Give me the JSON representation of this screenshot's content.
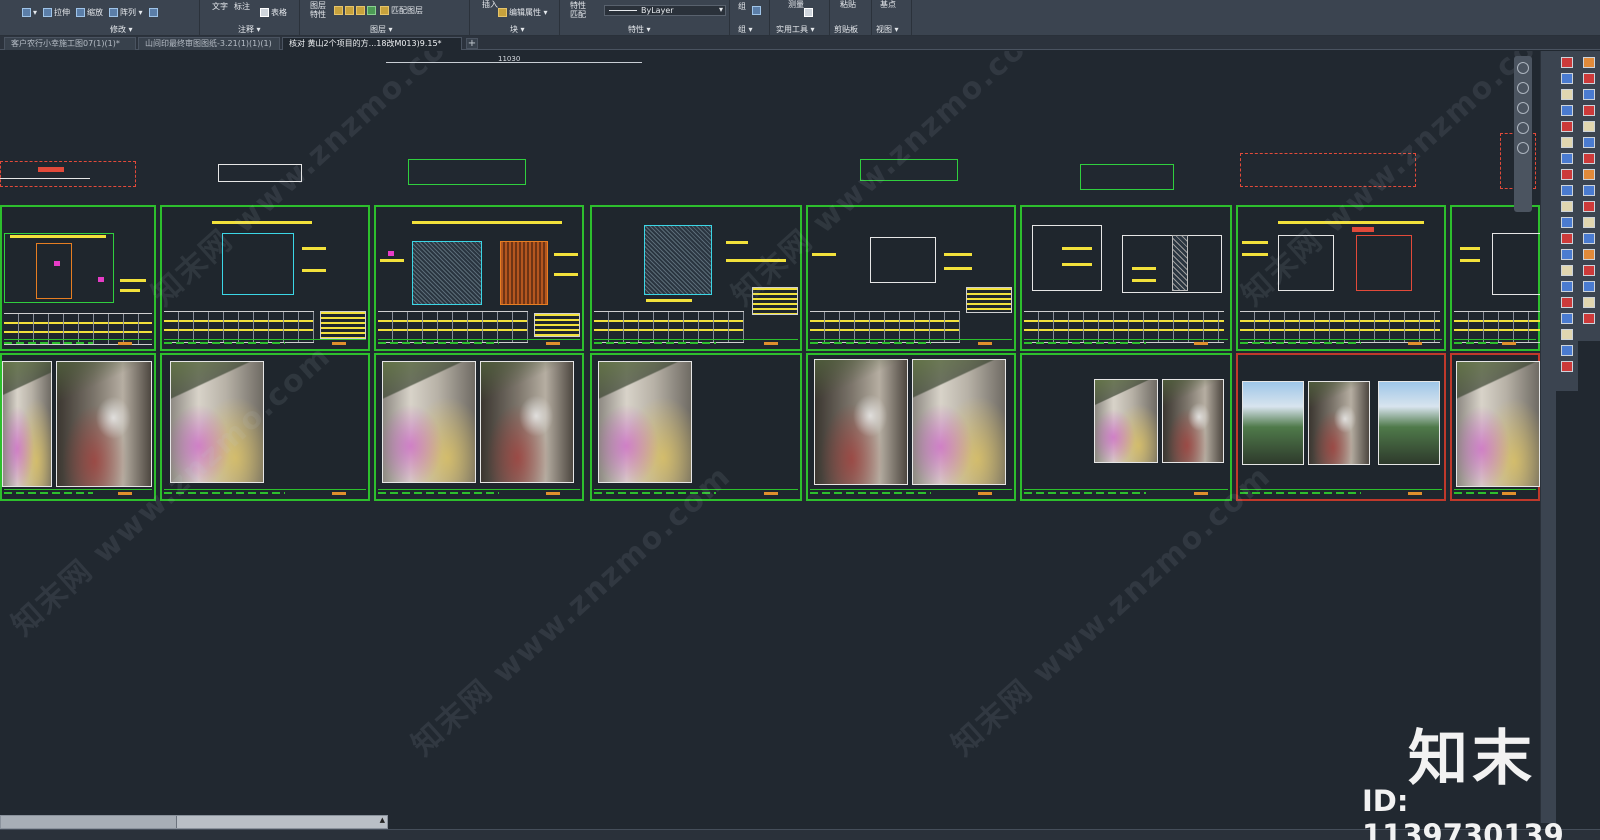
{
  "ribbon": {
    "groups": [
      {
        "name": "modify",
        "label": "修改 ▾",
        "buttons": [
          "拉伸",
          "缩放",
          "阵列 ▾"
        ]
      },
      {
        "name": "annotation",
        "label": "注释 ▾",
        "buttons": [
          "文字",
          "标注",
          "表格"
        ]
      },
      {
        "name": "layers",
        "label": "图层 ▾",
        "buttons": [
          "图层特性",
          "匹配图层"
        ]
      },
      {
        "name": "block",
        "label": "块 ▾",
        "buttons": [
          "插入",
          "编辑属性 ▾"
        ]
      },
      {
        "name": "properties",
        "label": "特性 ▾",
        "buttons": [
          "特性匹配"
        ],
        "dropdown": "ByLayer"
      },
      {
        "name": "groups",
        "label": "组 ▾",
        "buttons": [
          "组"
        ]
      },
      {
        "name": "utilities",
        "label": "实用工具 ▾",
        "buttons": [
          "测量"
        ]
      },
      {
        "name": "clipboard",
        "label": "剪贴板",
        "buttons": [
          "粘贴"
        ]
      },
      {
        "name": "view",
        "label": "视图 ▾",
        "buttons": [
          "基点"
        ]
      }
    ]
  },
  "tabs": [
    {
      "label": "客户农行小幸施工图07(1)(1)*",
      "active": false
    },
    {
      "label": "山间印最终审图图纸-3.21(1)(1)(1)",
      "active": false
    },
    {
      "label": "核对 黄山2个项目的方...18改M013)9.15*",
      "active": true
    }
  ],
  "canvas": {
    "dimension": "11030",
    "watermark": "知末网 www.znzmo.com"
  },
  "logo": {
    "text": "知末",
    "id": "ID: 1139730139"
  },
  "colors": {
    "background": "#212830",
    "sheet_border": "#2dbf2d",
    "annotation": "#f2e13b",
    "accent_red": "#c0392b"
  }
}
